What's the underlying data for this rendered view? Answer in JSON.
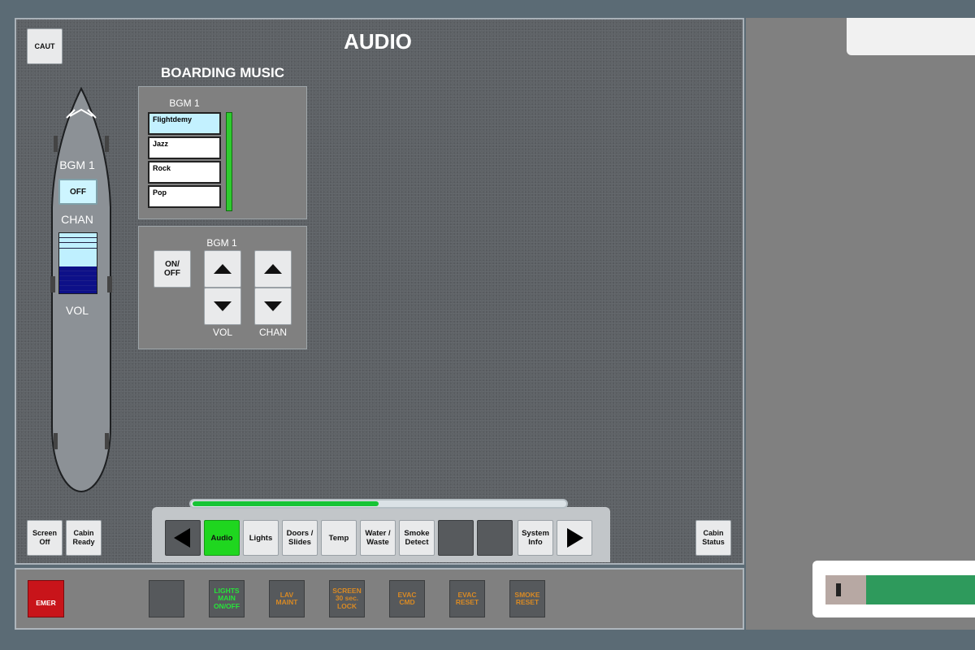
{
  "title": "AUDIO",
  "caut_label": "CAUT",
  "aircraft": {
    "bgm_label": "BGM 1",
    "bgm_state": "OFF",
    "chan_label": "CHAN",
    "vol_label": "VOL",
    "volume_level": 0.45
  },
  "boarding_music": {
    "title": "BOARDING MUSIC",
    "channel_label": "BGM 1",
    "songs": [
      "Flightdemy",
      "Jazz",
      "Rock",
      "Pop"
    ],
    "selected_index": 0
  },
  "controls": {
    "channel_label": "BGM 1",
    "onoff_label": "ON/\nOFF",
    "vol_label": "VOL",
    "chan_label": "CHAN"
  },
  "left_buttons": {
    "screen_off": "Screen\nOff",
    "cabin_ready": "Cabin\nReady"
  },
  "cabin_status": "Cabin\nStatus",
  "nav": {
    "progress": 0.5,
    "items": [
      "Audio",
      "Lights",
      "Doors /\nSlides",
      "Temp",
      "Water /\nWaste",
      "Smoke\nDetect",
      "",
      "",
      "System\nInfo"
    ],
    "active_index": 0
  },
  "strip": {
    "emer_label": "EMER",
    "buttons": [
      "",
      "LIGHTS\nMAIN\nON/OFF",
      "LAV\nMAINT",
      "SCREEN\n30 sec.\nLOCK",
      "EVAC\nCMD",
      "EVAC\nRESET",
      "SMOKE\nRESET"
    ]
  },
  "colors": {
    "active": "#1fd61f",
    "lights_text": "#27e33a",
    "amber_text": "#d98a24",
    "emer": "#c8141a"
  }
}
